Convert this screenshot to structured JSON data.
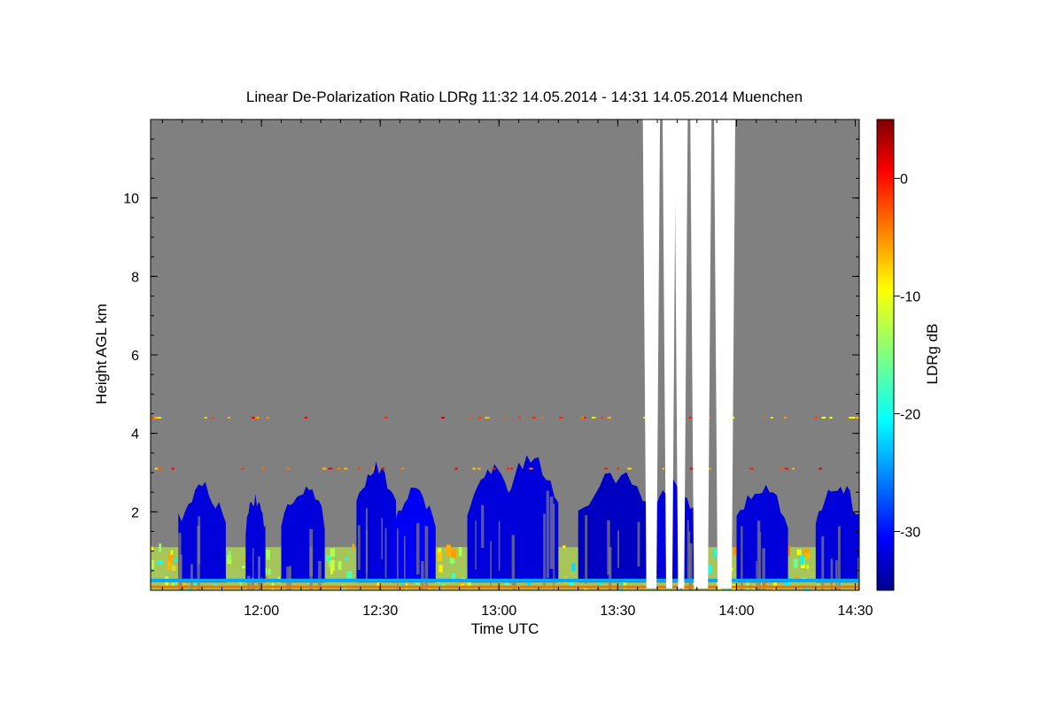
{
  "chart_data": {
    "type": "heatmap",
    "title": "Linear De-Polarization Ratio LDRg   11:32 14.05.2014 - 14:31 14.05.2014 Muenchen",
    "xlabel": "Time UTC",
    "ylabel": "Height AGL km",
    "x_range": [
      "11:32",
      "14:31"
    ],
    "ylim": [
      0,
      12
    ],
    "x_ticks": [
      {
        "time": "12:00",
        "label": "12:00"
      },
      {
        "time": "12:30",
        "label": "12:30"
      },
      {
        "time": "13:00",
        "label": "13:00"
      },
      {
        "time": "13:30",
        "label": "13:30"
      },
      {
        "time": "14:00",
        "label": "14:00"
      },
      {
        "time": "14:30",
        "label": "14:30"
      }
    ],
    "y_ticks": [
      {
        "value": 2,
        "label": "2"
      },
      {
        "value": 4,
        "label": "4"
      },
      {
        "value": 6,
        "label": "6"
      },
      {
        "value": 8,
        "label": "8"
      },
      {
        "value": 10,
        "label": "10"
      }
    ],
    "colorbar": {
      "label": "LDRg dB",
      "range": [
        -35,
        5
      ],
      "colormap": "jet",
      "ticks": [
        {
          "value": 0,
          "label": "0"
        },
        {
          "value": -10,
          "label": "-10"
        },
        {
          "value": -20,
          "label": "-20"
        },
        {
          "value": -30,
          "label": "-30"
        }
      ]
    },
    "background_color": "#808080",
    "no_data_color": "#ffffff",
    "grid": false,
    "features": {
      "cloud_bands": [
        {
          "start": "11:39",
          "end": "11:51",
          "top_km": 2.6,
          "ldr_db": -32
        },
        {
          "start": "11:56",
          "end": "12:01",
          "top_km": 2.3,
          "ldr_db": -32
        },
        {
          "start": "12:05",
          "end": "12:16",
          "top_km": 2.6,
          "ldr_db": -32
        },
        {
          "start": "12:24",
          "end": "12:34",
          "top_km": 3.1,
          "ldr_db": -32
        },
        {
          "start": "12:33",
          "end": "12:44",
          "top_km": 2.5,
          "ldr_db": -31
        },
        {
          "start": "12:52",
          "end": "13:04",
          "top_km": 3.1,
          "ldr_db": -32
        },
        {
          "start": "13:01",
          "end": "13:15",
          "top_km": 3.3,
          "ldr_db": -32
        },
        {
          "start": "13:20",
          "end": "13:39",
          "top_km": 2.9,
          "ldr_db": -33
        },
        {
          "start": "13:38",
          "end": "13:50",
          "top_km": 2.7,
          "ldr_db": -32
        },
        {
          "start": "14:00",
          "end": "14:13",
          "top_km": 2.6,
          "ldr_db": -32
        },
        {
          "start": "14:20",
          "end": "14:31",
          "top_km": 2.7,
          "ldr_db": -32
        }
      ],
      "boundary_layer": {
        "top_km": 1.1,
        "ldr_db": -12
      },
      "surface_line": {
        "height_km": 0.25,
        "ldr_db": -24
      },
      "no_data_gaps": [
        {
          "start": "13:37",
          "end": "13:40"
        },
        {
          "start": "13:42",
          "end": "13:44"
        },
        {
          "start": "13:45",
          "end": "13:47"
        },
        {
          "start": "13:49",
          "end": "13:53"
        },
        {
          "start": "13:55",
          "end": "13:59"
        }
      ],
      "aerosol_layer_km": [
        4.4,
        3.1
      ]
    }
  }
}
